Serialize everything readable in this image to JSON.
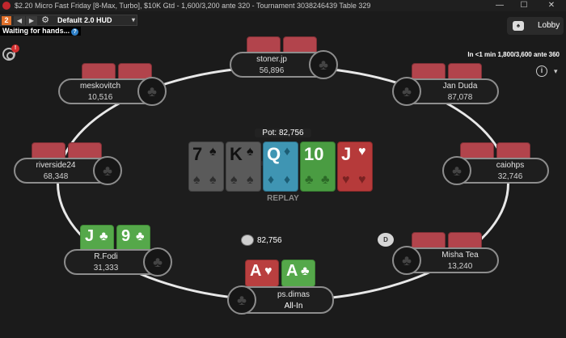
{
  "window": {
    "title": "$2.20 Micro Fast Friday [8-Max, Turbo], $10K Gtd - 1,600/3,200 ante 320 - Tournament 3038246439 Table 329",
    "min": "—",
    "max": "☐",
    "close": "✕"
  },
  "hud": {
    "badge": "2",
    "prev": "◀",
    "next": "▶",
    "gear": "⚙",
    "profile": "Default 2.0 HUD",
    "caret": "▾",
    "status": "Waiting for hands...",
    "help": "?"
  },
  "alert_count": "!",
  "lobby_label": "Lobby",
  "blind_info": "In <1 min 1,800/3,600 ante 360",
  "info_label": "i",
  "menu_caret": "▾",
  "pot": {
    "label": "Pot: 82,756",
    "amount": "82,756"
  },
  "replay": "REPLAY",
  "dealer": "D",
  "board": [
    {
      "rank": "7",
      "suit": "♠",
      "style": "dim"
    },
    {
      "rank": "K",
      "suit": "♠",
      "style": "dim"
    },
    {
      "rank": "Q",
      "suit": "♦",
      "style": "blue"
    },
    {
      "rank": "10",
      "suit": "♣",
      "style": "green"
    },
    {
      "rank": "J",
      "suit": "♥",
      "style": "red"
    }
  ],
  "players": {
    "top": {
      "name": "stoner.jp",
      "stack": "56,896"
    },
    "top_left": {
      "name": "meskovitch",
      "stack": "10,516"
    },
    "top_right": {
      "name": "Jan Duda",
      "stack": "87,078"
    },
    "left": {
      "name": "riverside24",
      "stack": "68,348"
    },
    "right": {
      "name": "caiohps",
      "stack": "32,746"
    },
    "bottom_left": {
      "name": "R.Fodi",
      "stack": "31,333",
      "cards": [
        {
          "rank": "J",
          "suit": "♣"
        },
        {
          "rank": "9",
          "suit": "♣"
        }
      ]
    },
    "bottom_right": {
      "name": "Misha Tea",
      "stack": "13,240"
    },
    "hero": {
      "name": "ps.dimas",
      "stack": "All-In",
      "cards": [
        {
          "rank": "A",
          "suit": "♥"
        },
        {
          "rank": "A",
          "suit": "♣"
        }
      ]
    }
  },
  "colors": {
    "card_back": "#b2444c",
    "card_green": "#55a84a",
    "card_red": "#b93f3f",
    "card_blue": "#3f95b3",
    "table_rail": "#e8e8e8"
  }
}
